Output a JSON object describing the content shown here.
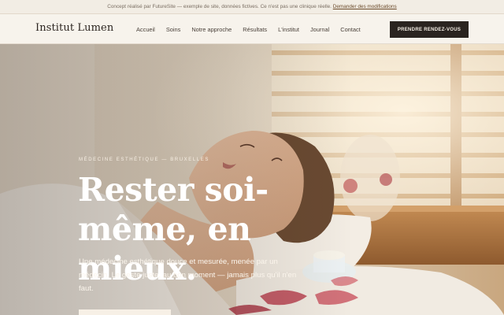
{
  "banner": {
    "text": "Concept réalisé par FutureSite — exemple de site, données fictives. Ce n'est pas une clinique réelle. ",
    "link": "Demander des modifications"
  },
  "header": {
    "logo": "Institut Lumen",
    "nav": [
      "Accueil",
      "Soins",
      "Notre approche",
      "Résultats",
      "L'institut",
      "Journal",
      "Contact"
    ],
    "cta": "PRENDRE RENDEZ-VOUS"
  },
  "hero": {
    "eyebrow": "MÉDECINE ESTHÉTIQUE — BRUXELLES",
    "headline": "Rester soi-même, en mieux.",
    "subtext": "Une médecine esthétique douce et mesurée, menée par un médecin. Le geste juste, au bon moment — jamais plus qu'il n'en faut."
  }
}
